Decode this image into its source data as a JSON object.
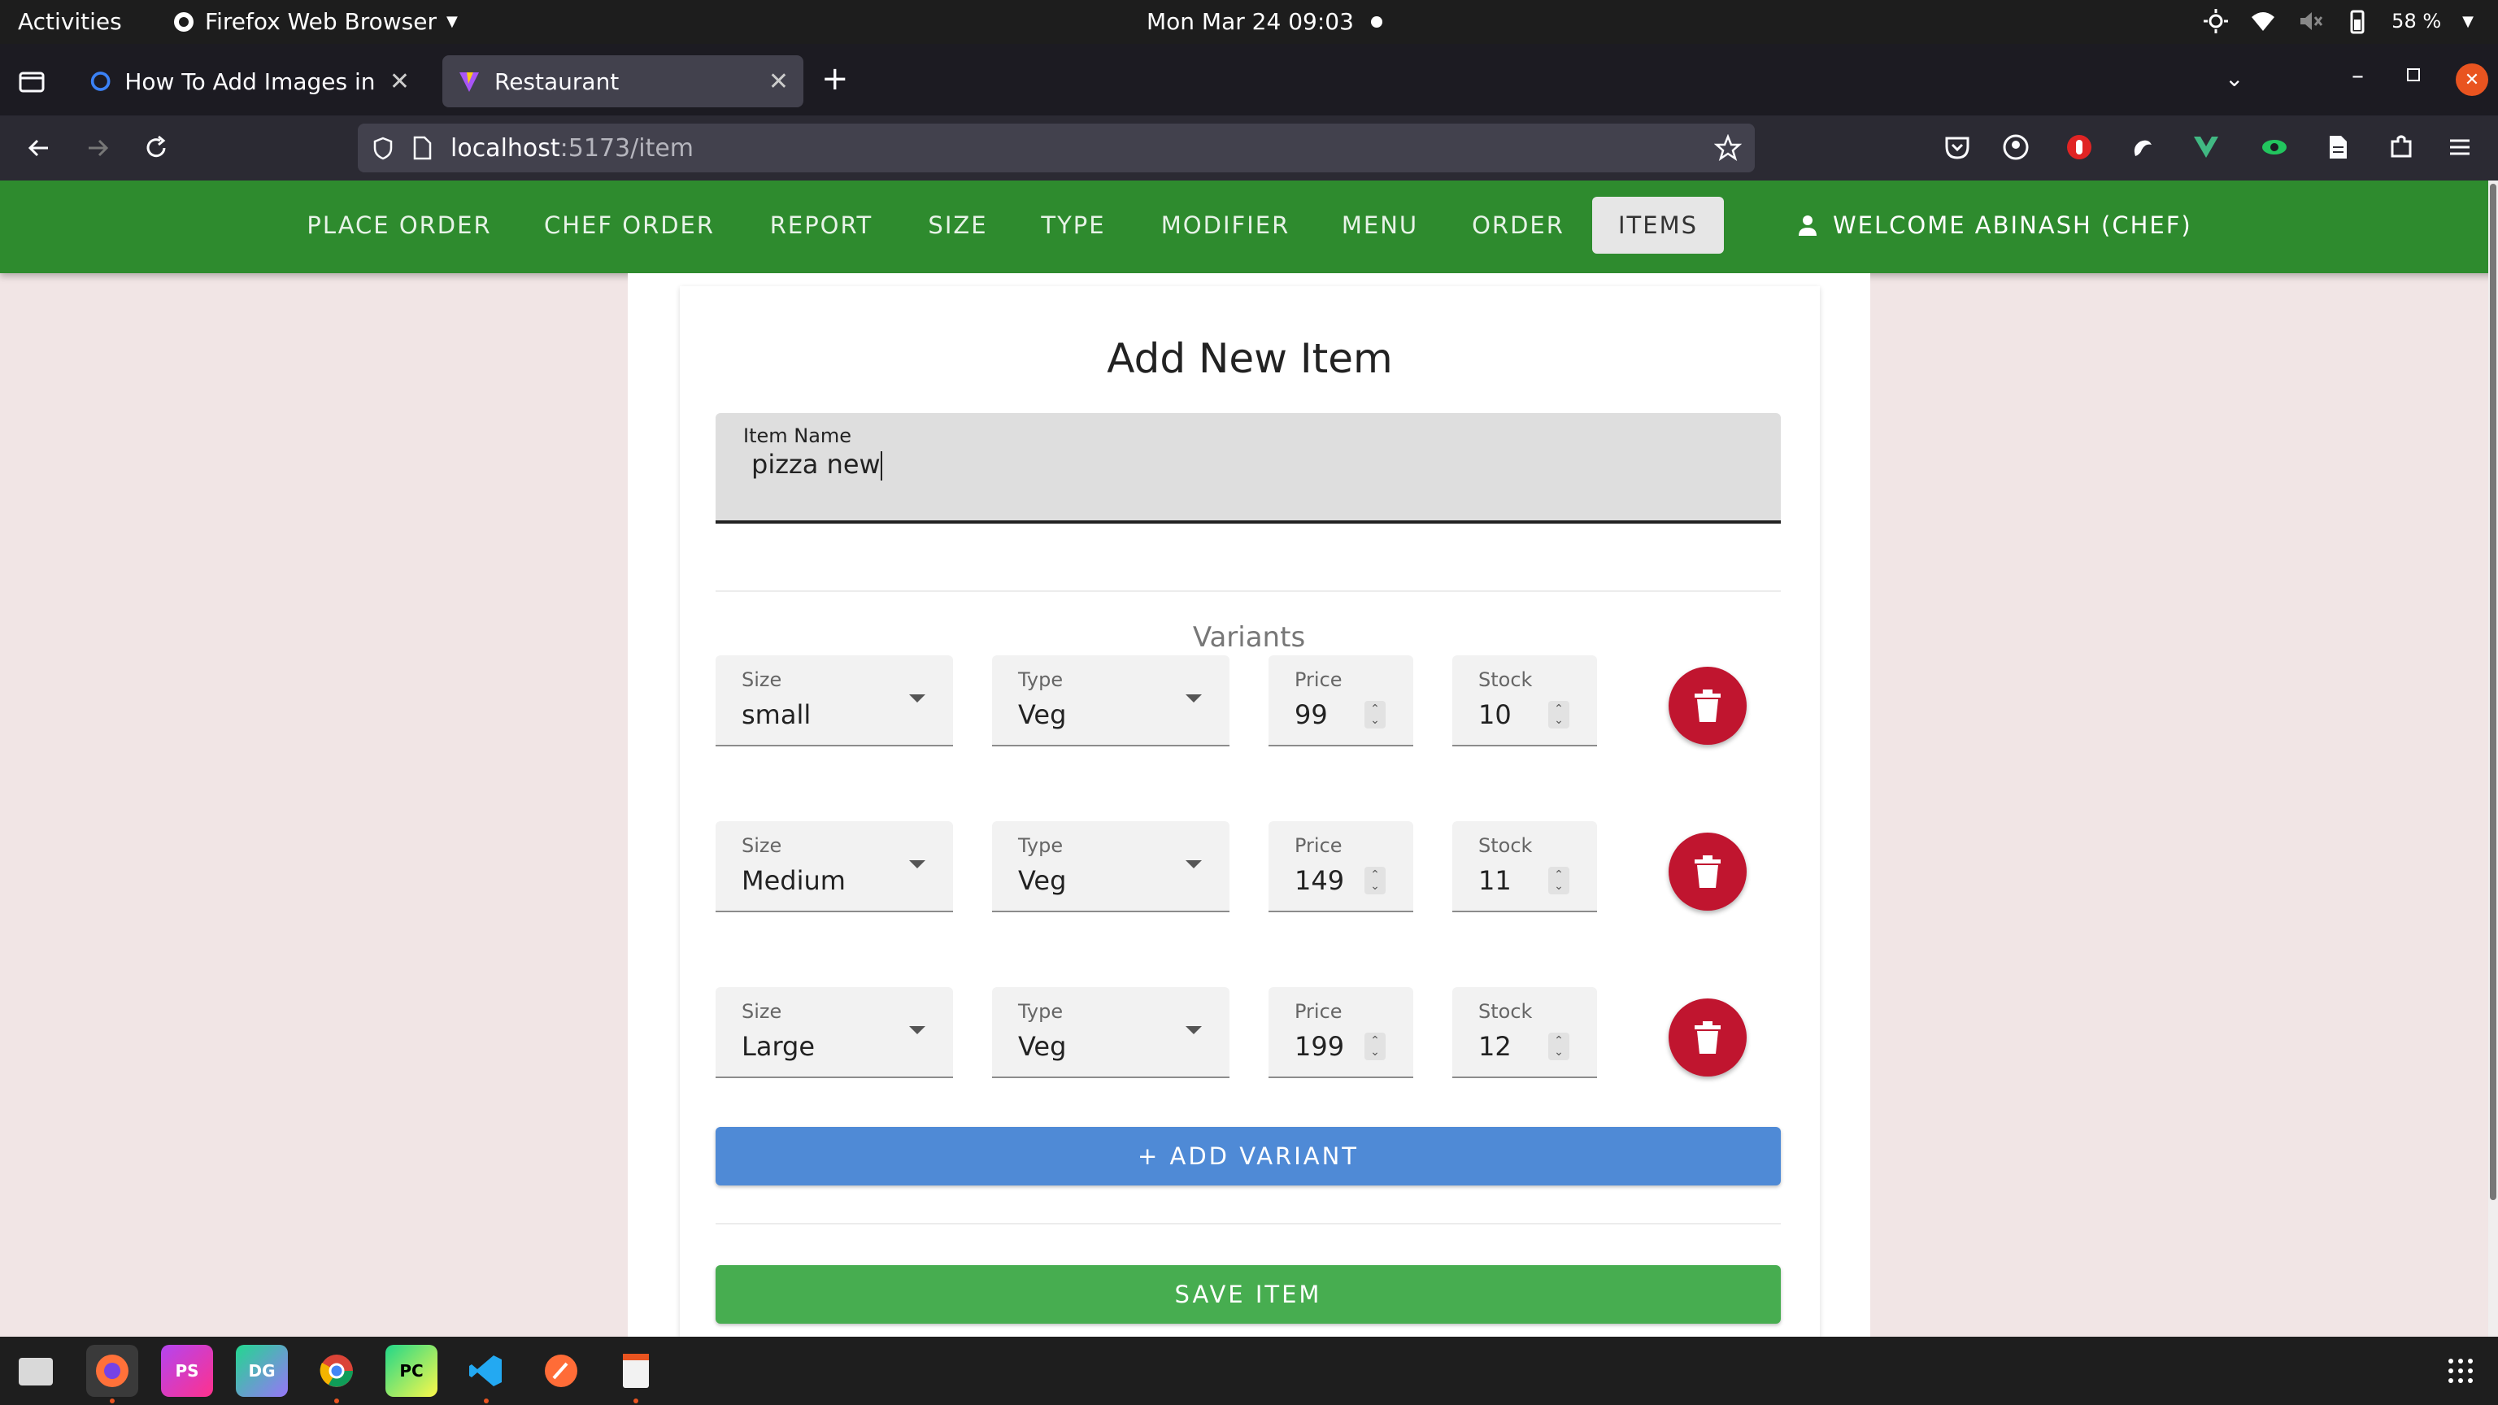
{
  "system": {
    "activities": "Activities",
    "app_name": "Firefox Web Browser",
    "clock": "Mon Mar 24  09:03",
    "battery": "58 %"
  },
  "browser": {
    "tabs": [
      {
        "title": "How To Add Images in Ma",
        "active": false
      },
      {
        "title": "Restaurant",
        "active": true
      }
    ],
    "url_host": "localhost",
    "url_path": ":5173/item"
  },
  "app": {
    "menu": [
      "PLACE ORDER",
      "CHEF ORDER",
      "REPORT",
      "SIZE",
      "TYPE",
      "MODIFIER",
      "MENU",
      "ORDER",
      "ITEMS"
    ],
    "active_menu": "ITEMS",
    "welcome": "WELCOME ABINASH (CHEF)",
    "accent": "#2e8b2e"
  },
  "form": {
    "title": "Add New Item",
    "item_name_label": "Item Name",
    "item_name_value": "pizza new",
    "variants_label": "Variants",
    "labels": {
      "size": "Size",
      "type": "Type",
      "price": "Price",
      "stock": "Stock"
    },
    "variants": [
      {
        "size": "small",
        "type": "Veg",
        "price": "99",
        "stock": "10"
      },
      {
        "size": "Medium",
        "type": "Veg",
        "price": "149",
        "stock": "11"
      },
      {
        "size": "Large",
        "type": "Veg",
        "price": "199",
        "stock": "12"
      }
    ],
    "add_variant": "+ ADD VARIANT",
    "save_item": "SAVE ITEM",
    "add_color": "#4f8ad6",
    "save_color": "#47ad50",
    "delete_color": "#c0152f"
  }
}
